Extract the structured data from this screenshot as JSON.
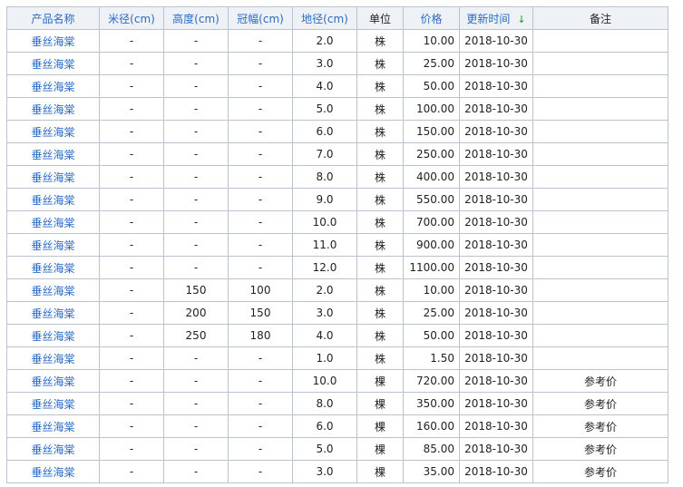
{
  "table": {
    "headers": {
      "name": "产品名称",
      "rice": "米径(cm)",
      "height": "高度(cm)",
      "crown": "冠幅(cm)",
      "ground": "地径(cm)",
      "unit": "单位",
      "price": "价格",
      "updated": "更新时间",
      "note": "备注"
    },
    "sort_indicator": "↓",
    "rows": [
      {
        "name": "垂丝海棠",
        "rice": "-",
        "height": "-",
        "crown": "-",
        "ground": "2.0",
        "unit": "株",
        "price": "10.00",
        "updated": "2018-10-30",
        "note": ""
      },
      {
        "name": "垂丝海棠",
        "rice": "-",
        "height": "-",
        "crown": "-",
        "ground": "3.0",
        "unit": "株",
        "price": "25.00",
        "updated": "2018-10-30",
        "note": ""
      },
      {
        "name": "垂丝海棠",
        "rice": "-",
        "height": "-",
        "crown": "-",
        "ground": "4.0",
        "unit": "株",
        "price": "50.00",
        "updated": "2018-10-30",
        "note": ""
      },
      {
        "name": "垂丝海棠",
        "rice": "-",
        "height": "-",
        "crown": "-",
        "ground": "5.0",
        "unit": "株",
        "price": "100.00",
        "updated": "2018-10-30",
        "note": ""
      },
      {
        "name": "垂丝海棠",
        "rice": "-",
        "height": "-",
        "crown": "-",
        "ground": "6.0",
        "unit": "株",
        "price": "150.00",
        "updated": "2018-10-30",
        "note": ""
      },
      {
        "name": "垂丝海棠",
        "rice": "-",
        "height": "-",
        "crown": "-",
        "ground": "7.0",
        "unit": "株",
        "price": "250.00",
        "updated": "2018-10-30",
        "note": ""
      },
      {
        "name": "垂丝海棠",
        "rice": "-",
        "height": "-",
        "crown": "-",
        "ground": "8.0",
        "unit": "株",
        "price": "400.00",
        "updated": "2018-10-30",
        "note": ""
      },
      {
        "name": "垂丝海棠",
        "rice": "-",
        "height": "-",
        "crown": "-",
        "ground": "9.0",
        "unit": "株",
        "price": "550.00",
        "updated": "2018-10-30",
        "note": ""
      },
      {
        "name": "垂丝海棠",
        "rice": "-",
        "height": "-",
        "crown": "-",
        "ground": "10.0",
        "unit": "株",
        "price": "700.00",
        "updated": "2018-10-30",
        "note": ""
      },
      {
        "name": "垂丝海棠",
        "rice": "-",
        "height": "-",
        "crown": "-",
        "ground": "11.0",
        "unit": "株",
        "price": "900.00",
        "updated": "2018-10-30",
        "note": ""
      },
      {
        "name": "垂丝海棠",
        "rice": "-",
        "height": "-",
        "crown": "-",
        "ground": "12.0",
        "unit": "株",
        "price": "1100.00",
        "updated": "2018-10-30",
        "note": ""
      },
      {
        "name": "垂丝海棠",
        "rice": "-",
        "height": "150",
        "crown": "100",
        "ground": "2.0",
        "unit": "株",
        "price": "10.00",
        "updated": "2018-10-30",
        "note": ""
      },
      {
        "name": "垂丝海棠",
        "rice": "-",
        "height": "200",
        "crown": "150",
        "ground": "3.0",
        "unit": "株",
        "price": "25.00",
        "updated": "2018-10-30",
        "note": ""
      },
      {
        "name": "垂丝海棠",
        "rice": "-",
        "height": "250",
        "crown": "180",
        "ground": "4.0",
        "unit": "株",
        "price": "50.00",
        "updated": "2018-10-30",
        "note": ""
      },
      {
        "name": "垂丝海棠",
        "rice": "-",
        "height": "-",
        "crown": "-",
        "ground": "1.0",
        "unit": "株",
        "price": "1.50",
        "updated": "2018-10-30",
        "note": ""
      },
      {
        "name": "垂丝海棠",
        "rice": "-",
        "height": "-",
        "crown": "-",
        "ground": "10.0",
        "unit": "棵",
        "price": "720.00",
        "updated": "2018-10-30",
        "note": "参考价"
      },
      {
        "name": "垂丝海棠",
        "rice": "-",
        "height": "-",
        "crown": "-",
        "ground": "8.0",
        "unit": "棵",
        "price": "350.00",
        "updated": "2018-10-30",
        "note": "参考价"
      },
      {
        "name": "垂丝海棠",
        "rice": "-",
        "height": "-",
        "crown": "-",
        "ground": "6.0",
        "unit": "棵",
        "price": "160.00",
        "updated": "2018-10-30",
        "note": "参考价"
      },
      {
        "name": "垂丝海棠",
        "rice": "-",
        "height": "-",
        "crown": "-",
        "ground": "5.0",
        "unit": "棵",
        "price": "85.00",
        "updated": "2018-10-30",
        "note": "参考价"
      },
      {
        "name": "垂丝海棠",
        "rice": "-",
        "height": "-",
        "crown": "-",
        "ground": "3.0",
        "unit": "棵",
        "price": "35.00",
        "updated": "2018-10-30",
        "note": "参考价"
      }
    ]
  },
  "colors": {
    "link": "#2a6bc7",
    "border": "#b9c4d0",
    "header_bg": "#eef2f6",
    "sort_arrow": "#1f9a2a"
  }
}
